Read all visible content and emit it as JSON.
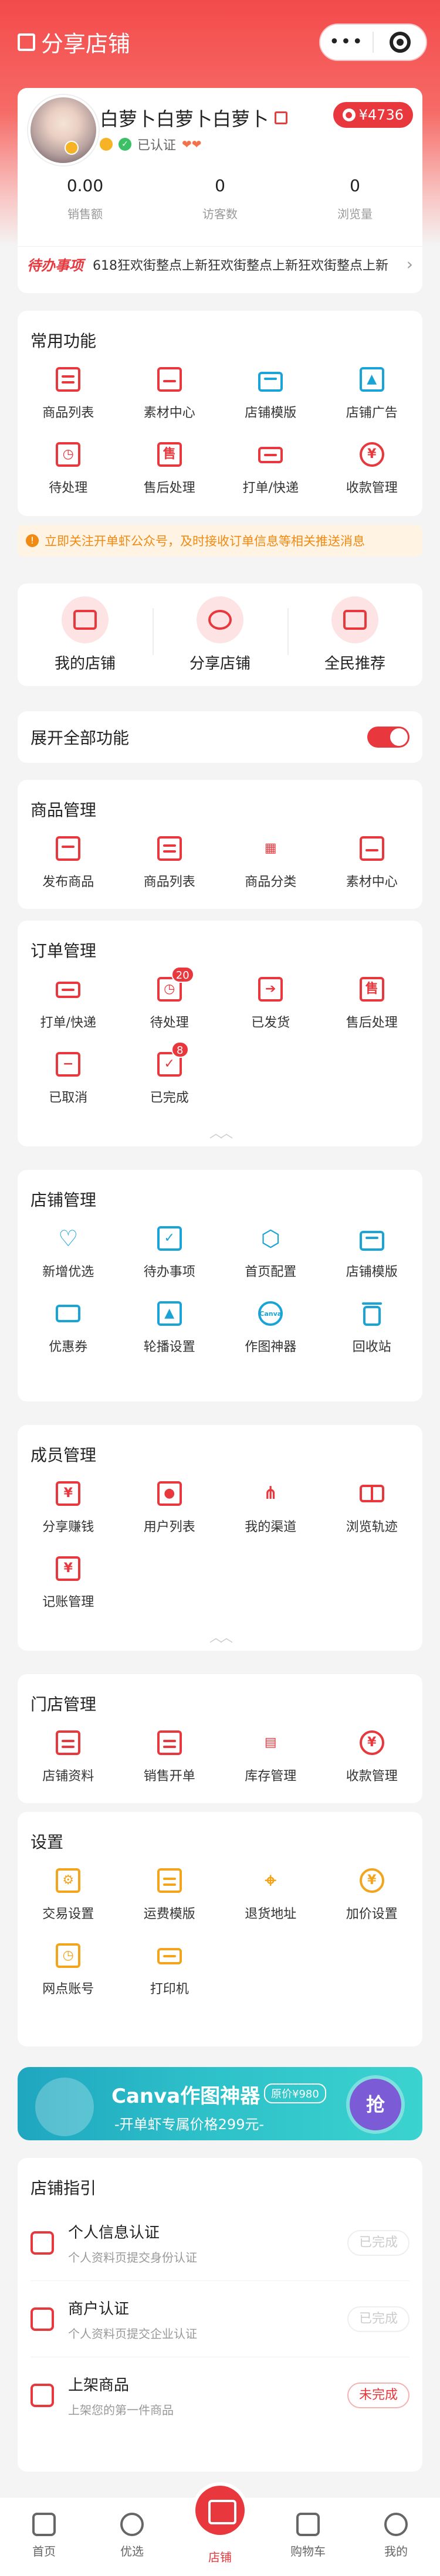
{
  "nav": {
    "title": "分享店铺",
    "capsule_dots": "•••"
  },
  "profile": {
    "name": "白萝卜白萝卜白萝卜",
    "balance": "¥4736",
    "verified": "已认证",
    "stats": [
      {
        "value": "0.00",
        "label": "销售额"
      },
      {
        "value": "0",
        "label": "访客数"
      },
      {
        "value": "0",
        "label": "浏览量"
      }
    ],
    "todo_tag": "待办事项",
    "todo_text": "618狂欢街整点上新狂欢街整点上新狂欢街整点上新"
  },
  "common": {
    "title": "常用功能",
    "items": [
      "商品列表",
      "素材中心",
      "店铺模版",
      "店铺广告",
      "待处理",
      "售后处理",
      "打单/快递",
      "收款管理"
    ]
  },
  "notice": "立即关注开单虾公众号，及时接收订单信息等相关推送消息",
  "quick": [
    "我的店铺",
    "分享店铺",
    "全民推荐"
  ],
  "toggle_label": "展开全部功能",
  "goods": {
    "title": "商品管理",
    "items": [
      "发布商品",
      "商品列表",
      "商品分类",
      "素材中心"
    ]
  },
  "orders": {
    "title": "订单管理",
    "items": [
      "打单/快递",
      "待处理",
      "已发货",
      "售后处理",
      "已取消",
      "已完成"
    ],
    "badges": {
      "pending": "20",
      "done": "8"
    }
  },
  "shop": {
    "title": "店铺管理",
    "items": [
      "新增优选",
      "待办事项",
      "首页配置",
      "店铺模版",
      "优惠券",
      "轮播设置",
      "作图神器",
      "回收站"
    ]
  },
  "member": {
    "title": "成员管理",
    "items": [
      "分享赚钱",
      "用户列表",
      "我的渠道",
      "浏览轨迹",
      "记账管理"
    ]
  },
  "store": {
    "title": "门店管理",
    "items": [
      "店铺资料",
      "销售开单",
      "库存管理",
      "收款管理"
    ]
  },
  "settings": {
    "title": "设置",
    "items": [
      "交易设置",
      "运费模版",
      "退货地址",
      "加价设置",
      "网点账号",
      "打印机"
    ]
  },
  "banner": {
    "title": "Canva作图神器",
    "price_tag": "原价¥980",
    "subtitle": "-开单虾专属价格299元-",
    "grab": "抢"
  },
  "guide": {
    "title": "店铺指引",
    "rows": [
      {
        "title": "个人信息认证",
        "desc": "个人资料页提交身份认证",
        "status": "已完成"
      },
      {
        "title": "商户认证",
        "desc": "个人资料页提交企业认证",
        "status": "已完成"
      },
      {
        "title": "上架商品",
        "desc": "上架您的第一件商品",
        "status": "未完成"
      }
    ]
  },
  "tabs": [
    "首页",
    "优选",
    "店铺",
    "购物车",
    "我的"
  ],
  "colors": {
    "accent": "#e8383d",
    "blue": "#1aa3d6",
    "orange": "#f2a51c"
  }
}
